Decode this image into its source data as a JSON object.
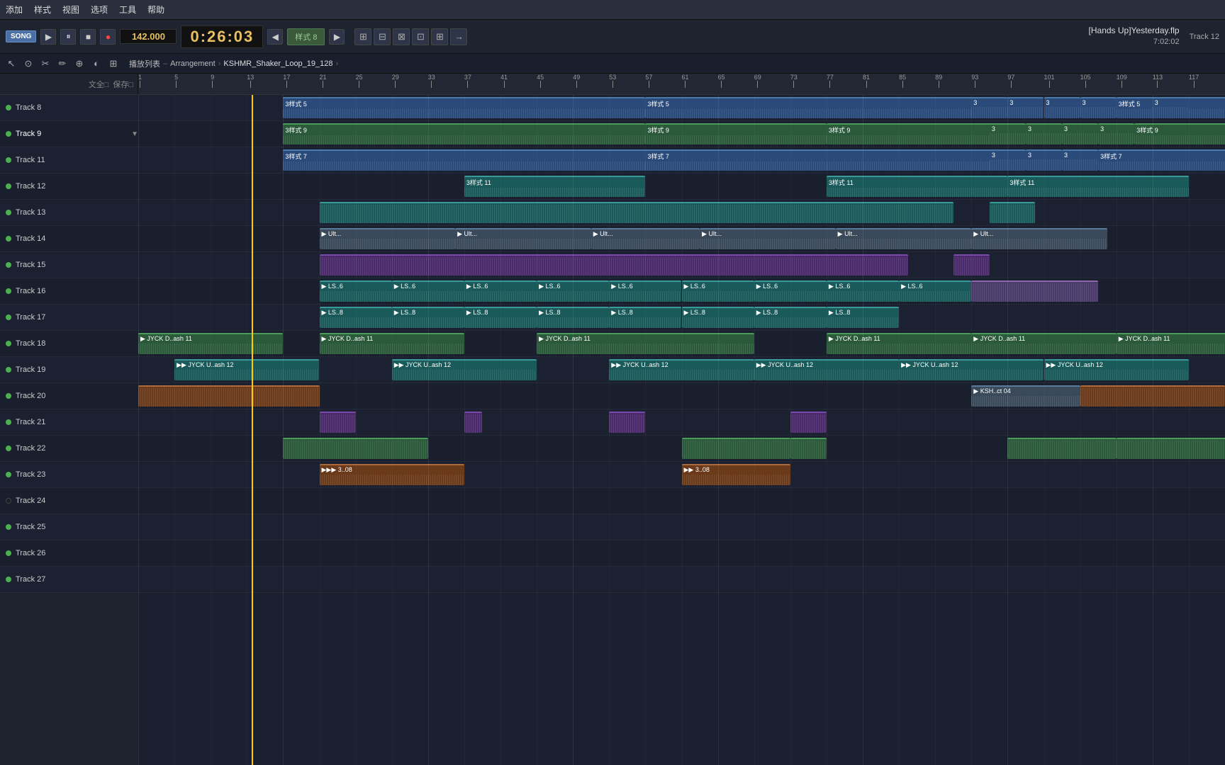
{
  "menubar": {
    "items": [
      "添加",
      "样式",
      "视图",
      "选项",
      "工具",
      "帮助"
    ]
  },
  "transport": {
    "song_label": "SONG",
    "tempo": "142.000",
    "time": "0:26:03",
    "pattern_label": "样式 8",
    "project_filename": "[Hands Up]Yesterday.flp",
    "project_time": "7:02:02",
    "current_track": "Track 12"
  },
  "toolbar": {
    "breadcrumb": {
      "part1": "播放列表",
      "sep1": "–",
      "part2": "Arrangement",
      "sep2": "›",
      "part3": "KSHMR_Shaker_Loop_19_128",
      "sep3": "›"
    }
  },
  "tracks": [
    {
      "id": 8,
      "name": "Track 8",
      "dot": true
    },
    {
      "id": 9,
      "name": "Track 9",
      "dot": true,
      "selected": true,
      "has_chevron": true
    },
    {
      "id": 11,
      "name": "Track 11",
      "dot": true
    },
    {
      "id": 12,
      "name": "Track 12",
      "dot": true
    },
    {
      "id": 13,
      "name": "Track 13",
      "dot": true
    },
    {
      "id": 14,
      "name": "Track 14",
      "dot": true
    },
    {
      "id": 15,
      "name": "Track 15",
      "dot": true
    },
    {
      "id": 16,
      "name": "Track 16",
      "dot": true
    },
    {
      "id": 17,
      "name": "Track 17",
      "dot": true
    },
    {
      "id": 18,
      "name": "Track 18",
      "dot": true
    },
    {
      "id": 19,
      "name": "Track 19",
      "dot": true
    },
    {
      "id": 20,
      "name": "Track 20",
      "dot": true
    },
    {
      "id": 21,
      "name": "Track 21",
      "dot": true
    },
    {
      "id": 22,
      "name": "Track 22",
      "dot": true
    },
    {
      "id": 23,
      "name": "Track 23",
      "dot": true
    },
    {
      "id": 24,
      "name": "Track 24",
      "dot": false
    },
    {
      "id": 25,
      "name": "Track 25",
      "dot": true
    },
    {
      "id": 26,
      "name": "Track 26",
      "dot": true
    },
    {
      "id": 27,
      "name": "Track 27",
      "dot": true
    }
  ],
  "ruler": {
    "marks": [
      1,
      5,
      9,
      13,
      17,
      21,
      25,
      29,
      33,
      37,
      41,
      45,
      49,
      53,
      57,
      61,
      65,
      69,
      73,
      77,
      81,
      85,
      89,
      93,
      97,
      101,
      105,
      109,
      113,
      117
    ]
  },
  "colors": {
    "accent": "#ffcc00",
    "background": "#1a1f2e",
    "track_panel": "#1e2330"
  }
}
